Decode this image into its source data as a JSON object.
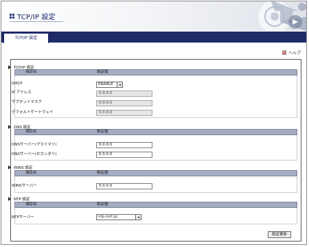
{
  "header": {
    "title": "TCP/IP 設定"
  },
  "tabs": [
    {
      "label": "TCP/IP 設定"
    }
  ],
  "help": {
    "label": "ヘルプ"
  },
  "table_headers": {
    "name": "項目名",
    "value": "設定値"
  },
  "sections": {
    "tcpip": {
      "title": "TCP/IP 設定",
      "dhcp_label": "DHCP",
      "dhcp_value": "ENABLE",
      "ip_label": "IP アドレス",
      "ip_value": "0.0.0.0",
      "subnet_label": "サブネットマスク",
      "subnet_value": "0.0.0.0",
      "gateway_label": "デフォルトゲートウェイ",
      "gateway_value": "0.0.0.0"
    },
    "dns": {
      "title": "DNS 設定",
      "primary_label": "DNSサーバー(プライマリ)",
      "primary_value": "0.0.0.0",
      "secondary_label": "DNSサーバー(セカンダリ)",
      "secondary_value": "0.0.0.0"
    },
    "wins": {
      "title": "WINS 設定",
      "server_label": "WINSサーバー",
      "server_value": "0.0.0.0"
    },
    "ntp": {
      "title": "NTP 設定",
      "server_label": "NTPサーバー",
      "server_value": "ntp.nict.jp"
    }
  },
  "buttons": {
    "update": "設定更新"
  },
  "colors": {
    "tab_bar": "#1f2a66",
    "table_header": "#a6adc2",
    "title_text": "#102060"
  }
}
